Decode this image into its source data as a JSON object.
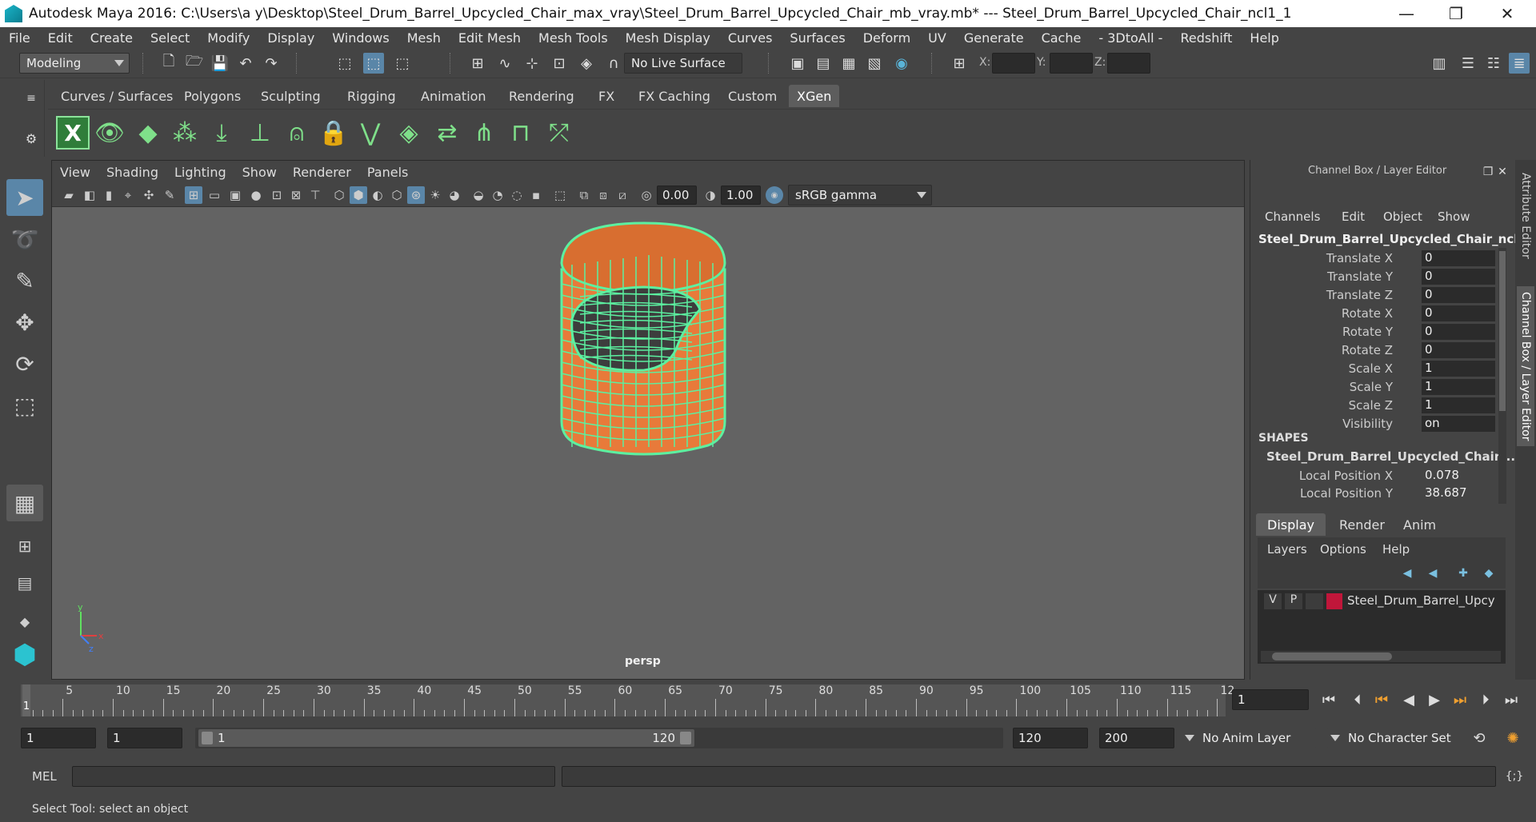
{
  "window": {
    "title": "Autodesk Maya 2016: C:\\Users\\a y\\Desktop\\Steel_Drum_Barrel_Upcycled_Chair_max_vray\\Steel_Drum_Barrel_Upcycled_Chair_mb_vray.mb*   ---   Steel_Drum_Barrel_Upcycled_Chair_ncl1_1",
    "minimize": "—",
    "maximize": "❐",
    "close": "✕"
  },
  "menubar": [
    "File",
    "Edit",
    "Create",
    "Select",
    "Modify",
    "Display",
    "Windows",
    "Mesh",
    "Edit Mesh",
    "Mesh Tools",
    "Mesh Display",
    "Curves",
    "Surfaces",
    "Deform",
    "UV",
    "Generate",
    "Cache",
    "- 3DtoAll -",
    "Redshift",
    "Help"
  ],
  "statusline": {
    "mode": "Modeling",
    "live_surface": "No Live Surface",
    "x_label": "X:",
    "y_label": "Y:",
    "z_label": "Z:"
  },
  "shelf_tabs": [
    "Curves / Surfaces",
    "Polygons",
    "Sculpting",
    "Rigging",
    "Animation",
    "Rendering",
    "FX",
    "FX Caching",
    "Custom",
    "XGen"
  ],
  "shelf_active": "XGen",
  "panel_menu": [
    "View",
    "Shading",
    "Lighting",
    "Show",
    "Renderer",
    "Panels"
  ],
  "panel_tools": {
    "exposure": "0.00",
    "gamma": "1.00",
    "color_space": "sRGB gamma"
  },
  "viewport": {
    "camera_label": "persp",
    "axis_y": "y",
    "axis_x": "x",
    "axis_z": "z",
    "colors": {
      "wire": "#5cf0a0",
      "body": "#e87a3a",
      "seat": "#3d3d3d"
    }
  },
  "channel_box": {
    "header": "Channel Box / Layer Editor",
    "menu": [
      "Channels",
      "Edit",
      "Object",
      "Show"
    ],
    "object_name": "Steel_Drum_Barrel_Upcycled_Chair_ncl...",
    "attributes": [
      {
        "name": "Translate X",
        "value": "0"
      },
      {
        "name": "Translate Y",
        "value": "0"
      },
      {
        "name": "Translate Z",
        "value": "0"
      },
      {
        "name": "Rotate X",
        "value": "0"
      },
      {
        "name": "Rotate Y",
        "value": "0"
      },
      {
        "name": "Rotate Z",
        "value": "0"
      },
      {
        "name": "Scale X",
        "value": "1"
      },
      {
        "name": "Scale Y",
        "value": "1"
      },
      {
        "name": "Scale Z",
        "value": "1"
      },
      {
        "name": "Visibility",
        "value": "on"
      }
    ],
    "shapes_label": "SHAPES",
    "shape_name": "Steel_Drum_Barrel_Upcycled_Chair_...",
    "shape_attributes": [
      {
        "name": "Local Position X",
        "value": "0.078"
      },
      {
        "name": "Local Position Y",
        "value": "38.687"
      }
    ]
  },
  "side_tabs": {
    "attribute_editor": "Attribute Editor",
    "channel_box": "Channel Box / Layer Editor"
  },
  "layer_editor": {
    "tabs": [
      "Display",
      "Render",
      "Anim"
    ],
    "active_tab": "Display",
    "menu": [
      "Layers",
      "Options",
      "Help"
    ],
    "layer": {
      "v": "V",
      "p": "P",
      "name": "Steel_Drum_Barrel_Upcy",
      "color": "#c0163a"
    }
  },
  "timeline": {
    "ticks": [
      "5",
      "10",
      "15",
      "20",
      "25",
      "30",
      "35",
      "40",
      "45",
      "50",
      "55",
      "60",
      "65",
      "70",
      "75",
      "80",
      "85",
      "90",
      "95",
      "100",
      "105",
      "110",
      "115",
      "12"
    ],
    "current_frame": "1",
    "current_frame_field": "1"
  },
  "range": {
    "start": "1",
    "playback_start": "1",
    "slider_start": "1",
    "slider_end": "120",
    "playback_end": "120",
    "end": "200",
    "anim_layer": "No Anim Layer",
    "character_set": "No Character Set"
  },
  "command_line": {
    "label": "MEL"
  },
  "help_line": "Select Tool: select an object"
}
